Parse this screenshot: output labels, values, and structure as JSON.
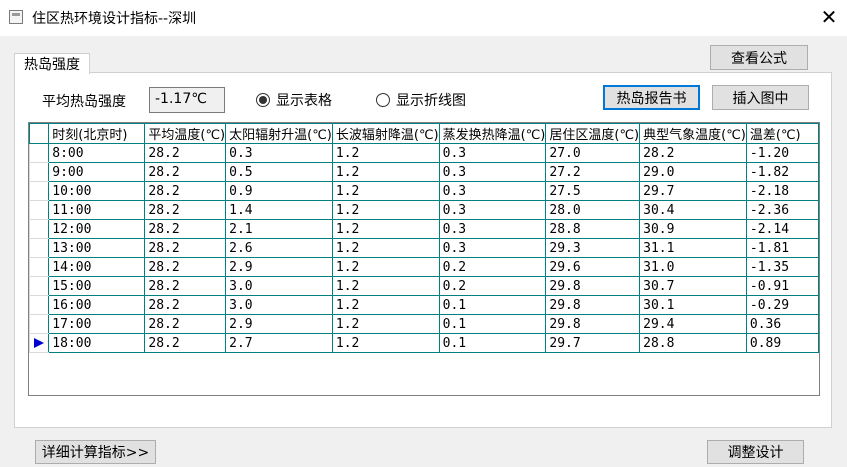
{
  "window": {
    "title": "住区热环境设计指标--深圳",
    "close_symbol": "✕"
  },
  "tab": {
    "label": "热岛强度"
  },
  "controls": {
    "view_formula": "查看公式",
    "heat_island_report": "热岛报告书",
    "insert_image": "插入图中",
    "avg_label": "平均热岛强度",
    "avg_value": "-1.17℃",
    "radio_table": "显示表格",
    "radio_chart": "显示折线图",
    "radio_selected": "table"
  },
  "grid": {
    "columns": [
      "时刻(北京时)",
      "平均温度(℃)",
      "太阳辐射升温(℃)",
      "长波辐射降温(℃)",
      "蒸发换热降温(℃)",
      "居住区温度(℃)",
      "典型气象温度(℃)",
      "温差(℃)"
    ],
    "rows": [
      [
        "8:00",
        "28.2",
        "0.3",
        "1.2",
        "0.3",
        "27.0",
        "28.2",
        "-1.20"
      ],
      [
        "9:00",
        "28.2",
        "0.5",
        "1.2",
        "0.3",
        "27.2",
        "29.0",
        "-1.82"
      ],
      [
        "10:00",
        "28.2",
        "0.9",
        "1.2",
        "0.3",
        "27.5",
        "29.7",
        "-2.18"
      ],
      [
        "11:00",
        "28.2",
        "1.4",
        "1.2",
        "0.3",
        "28.0",
        "30.4",
        "-2.36"
      ],
      [
        "12:00",
        "28.2",
        "2.1",
        "1.2",
        "0.3",
        "28.8",
        "30.9",
        "-2.14"
      ],
      [
        "13:00",
        "28.2",
        "2.6",
        "1.2",
        "0.3",
        "29.3",
        "31.1",
        "-1.81"
      ],
      [
        "14:00",
        "28.2",
        "2.9",
        "1.2",
        "0.2",
        "29.6",
        "31.0",
        "-1.35"
      ],
      [
        "15:00",
        "28.2",
        "3.0",
        "1.2",
        "0.2",
        "29.8",
        "30.7",
        "-0.91"
      ],
      [
        "16:00",
        "28.2",
        "3.0",
        "1.2",
        "0.1",
        "29.8",
        "30.1",
        "-0.29"
      ],
      [
        "17:00",
        "28.2",
        "2.9",
        "1.2",
        "0.1",
        "29.8",
        "29.4",
        "0.36"
      ],
      [
        "18:00",
        "28.2",
        "2.7",
        "1.2",
        "0.1",
        "29.7",
        "28.8",
        "0.89"
      ]
    ],
    "current_row_index": 10
  },
  "footer": {
    "detail_button": "详细计算指标>>",
    "adjust_button": "调整设计"
  },
  "colors": {
    "grid_line": "#008080",
    "row_pointer": "#0000cc",
    "focus_border": "#0078d7"
  }
}
